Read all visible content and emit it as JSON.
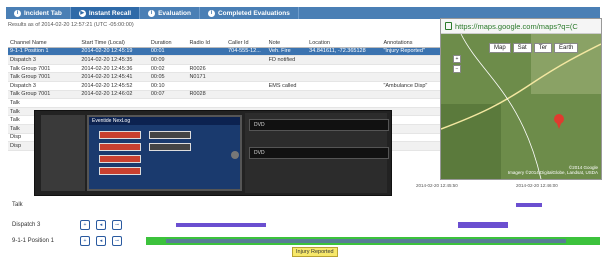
{
  "tabs": [
    {
      "label": "Incident Tab",
      "icon": "info-icon"
    },
    {
      "label": "Instant Recall",
      "icon": "play-icon"
    },
    {
      "label": "Evaluation",
      "icon": "info-icon"
    },
    {
      "label": "Completed Evaluations",
      "icon": "info-icon"
    }
  ],
  "results_label": "Results as of 2014-02-20 12:57:21 (UTC -05:00:00)",
  "columns": [
    "Channel Name",
    "Start Time (Local)",
    "Duration",
    "Radio Id",
    "Caller Id",
    "Note",
    "Location",
    "Annotations"
  ],
  "rows": [
    [
      "9-1-1 Position 1",
      "2014-02-20 12:45:19",
      "00:01",
      "",
      "704-555-12...",
      "Veh. Fire",
      "34.841611, -72.365128",
      "\"Injury Reported\""
    ],
    [
      "Dispatch 3",
      "2014-02-20 12:45:35",
      "00:09",
      "",
      "",
      "FD notified",
      "",
      ""
    ],
    [
      "Talk Group 7001",
      "2014-02-20 12:45:36",
      "00:02",
      "R0026",
      "",
      "",
      "",
      ""
    ],
    [
      "Talk Group 7001",
      "2014-02-20 12:45:41",
      "00:05",
      "N0171",
      "",
      "",
      "",
      ""
    ],
    [
      "Dispatch 3",
      "2014-02-20 12:45:52",
      "00:10",
      "",
      "",
      "EMS called",
      "",
      "\"Ambulance Disp\""
    ],
    [
      "Talk Group 7001",
      "2014-02-20 12:46:02",
      "00:07",
      "R0028",
      "",
      "",
      "",
      ""
    ],
    [
      "Talk",
      "",
      "",
      "",
      "",
      "",
      "",
      ""
    ],
    [
      "Talk",
      "",
      "",
      "",
      "",
      "",
      "",
      ""
    ],
    [
      "Talk",
      "",
      "",
      "",
      "",
      "",
      "",
      ""
    ],
    [
      "Talk",
      "",
      "",
      "",
      "",
      "",
      "",
      ""
    ],
    [
      "Disp",
      "",
      "",
      "",
      "",
      "",
      "",
      ""
    ],
    [
      "Disp",
      "",
      "",
      "",
      "",
      "",
      "",
      ""
    ]
  ],
  "map": {
    "url": "https://maps.google.com/maps?q=(C",
    "buttons": [
      "Map",
      "Sat",
      "Ter",
      "Earth"
    ],
    "copyright": "©2014 Google",
    "imagery": "Imagery ©2014 DigitalGlobe, Landsat, USDA"
  },
  "device": {
    "brand": "Eventide",
    "model": "NexLog",
    "drive_label": "DVD"
  },
  "timeline": {
    "ticks": [
      "2014-02-20 12:45:50",
      "2014-02-20 12:46:00"
    ],
    "rows": [
      {
        "label": "Talk"
      },
      {
        "label": "Dispatch 3"
      },
      {
        "label": "9-1-1 Position 1"
      }
    ],
    "marker": "Injury Reported"
  },
  "colors": {
    "tab_bar": "#4a7fb5",
    "selected_row": "#3b73b0",
    "track_purple": "#6b4fd0",
    "track_green": "#3cc23c"
  }
}
